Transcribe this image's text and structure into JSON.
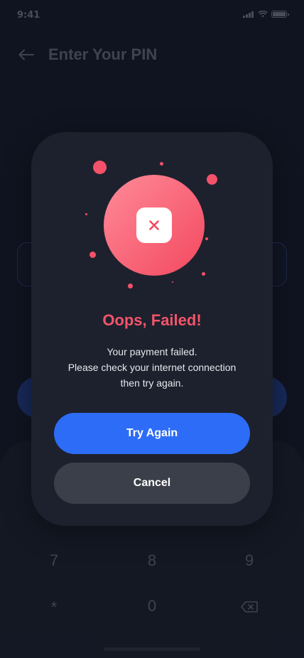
{
  "status_bar": {
    "time": "9:41"
  },
  "header": {
    "title": "Enter Your PIN",
    "back_icon": "arrow-left-icon"
  },
  "keypad": {
    "keys_row3": [
      "7",
      "8",
      "9"
    ],
    "keys_row4": [
      "*",
      "0"
    ],
    "backspace_icon": "backspace-icon"
  },
  "modal": {
    "icon": "close-icon",
    "title": "Oops, Failed!",
    "message_lines": [
      "Your payment failed.",
      "Please check your internet connection",
      "then try again."
    ],
    "primary_button": "Try Again",
    "secondary_button": "Cancel"
  },
  "colors": {
    "background": "#141a28",
    "modal": "#1d212d",
    "accent_error": "#f4546a",
    "primary_button": "#2d6cf6",
    "secondary_button": "#3b3f49"
  }
}
